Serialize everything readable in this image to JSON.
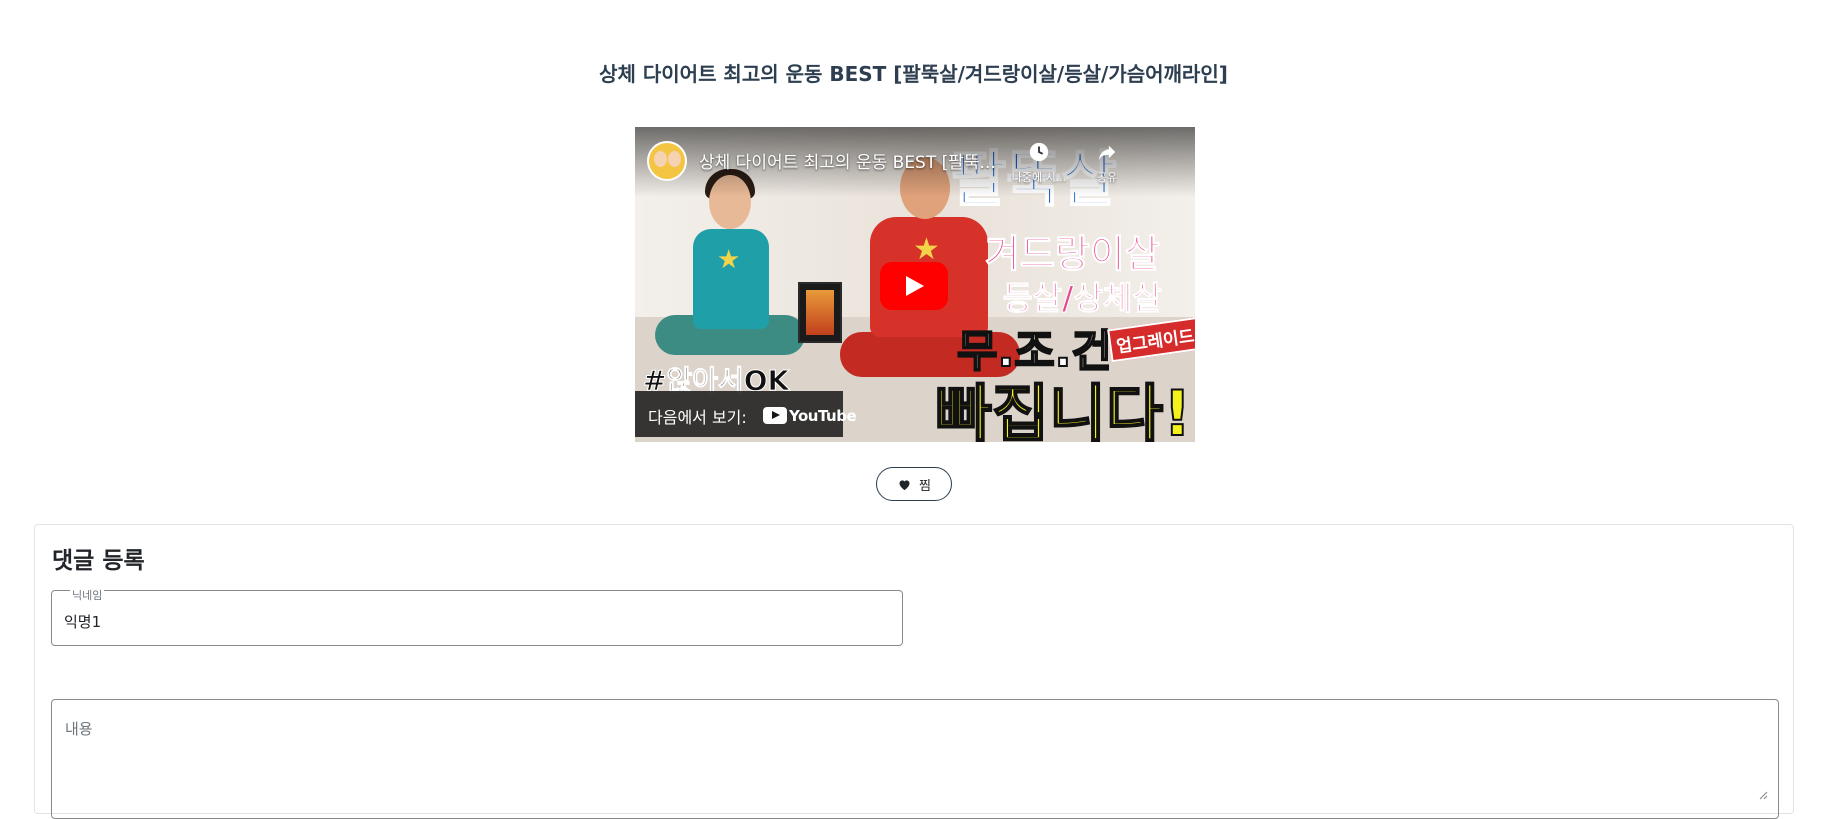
{
  "page": {
    "title": "상체 다이어트 최고의 운동 BEST [팔뚝살/겨드랑이살/등살/가슴어깨라인]"
  },
  "video": {
    "title": "상체 다이어트 최고의 운동 BEST [팔뚝...",
    "watch_later_label": "나중에 시...",
    "share_label": "공유",
    "watch_on_label": "다음에서 보기:",
    "youtube_logo": "YouTube",
    "thumbnail_text": {
      "main": "팔뚝살",
      "sub1": "겨드랑이살",
      "sub2": "등살/상체살",
      "sub3": "무.조.건",
      "badge": "업그레이드",
      "big": "빠집니다!",
      "hashtag": "#앉아서OK"
    },
    "play_button_color": "#ff0000",
    "icons": [
      "clock-icon",
      "share-icon",
      "youtube-play-icon"
    ]
  },
  "like": {
    "label": "찜",
    "icon": "heart-icon"
  },
  "comment_form": {
    "title": "댓글 등록",
    "nickname_label": "닉네임",
    "nickname_value": "익명1",
    "content_placeholder": "내용"
  },
  "colors": {
    "accent": "#2c3e50",
    "youtube_red": "#ff0000"
  }
}
